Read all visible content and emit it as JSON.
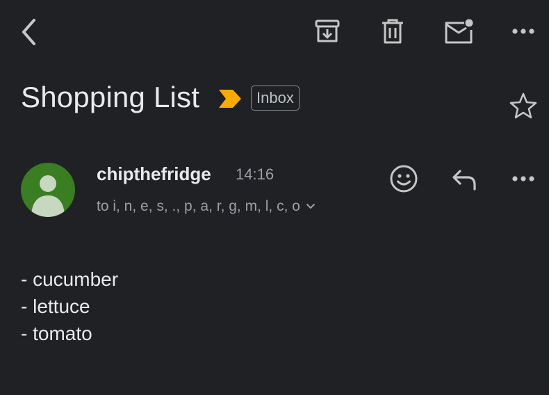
{
  "toolbar": {
    "back_icon": "chevron-left-icon",
    "archive_icon": "archive-icon",
    "delete_icon": "trash-icon",
    "mark_unread_icon": "mail-unread-icon",
    "more_icon": "more-horizontal-icon"
  },
  "subject": {
    "text": "Shopping List",
    "importance_icon": "importance-marker-icon",
    "importance_color": "#f9ab00",
    "label": "Inbox",
    "star_icon": "star-outline-icon"
  },
  "message": {
    "avatar_color": "#3a7d22",
    "avatar_icon": "person-silhouette-icon",
    "sender": "chipthefridge",
    "time": "14:16",
    "recipients": "to i, n, e, s, ., p, a, r, g, m, l, c, o",
    "expand_icon": "chevron-down-icon",
    "emoji_icon": "emoji-reaction-icon",
    "reply_icon": "reply-icon",
    "more_icon": "more-horizontal-icon"
  },
  "body": {
    "lines": [
      "- cucumber",
      "- lettuce",
      "- tomato"
    ]
  },
  "colors": {
    "background": "#202124",
    "text": "#e8eaed",
    "secondary_text": "#9aa0a6",
    "icon": "#c4c7c5"
  }
}
